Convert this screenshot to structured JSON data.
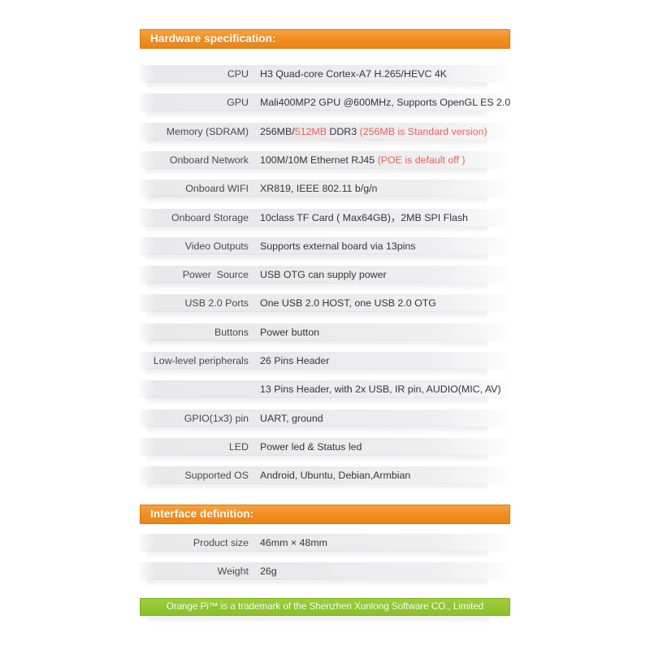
{
  "sections": {
    "hardware": {
      "title": "Hardware specification:"
    },
    "interface": {
      "title": "Interface definition:"
    }
  },
  "hardware_rows": [
    {
      "label": "CPU",
      "value": "H3 Quad-core Cortex-A7 H.265/HEVC 4K"
    },
    {
      "label": "GPU",
      "value": "Mali400MP2 GPU @600MHz, Supports OpenGL ES 2.0"
    },
    {
      "label": "Memory (SDRAM)",
      "value": "256MB/512MB DDR3 (256MB is Standard version)"
    },
    {
      "label": "Onboard Network",
      "value": "100M/10M Ethernet RJ45 (POE is default off )"
    },
    {
      "label": "Onboard WIFI",
      "value": "XR819, IEEE 802.11 b/g/n"
    },
    {
      "label": "Onboard Storage",
      "value": "10class TF Card ( Max64GB)，2MB SPI Flash"
    },
    {
      "label": "Video Outputs",
      "value": "Supports external board via 13pins"
    },
    {
      "label": "Power  Source",
      "value": "USB OTG can supply power"
    },
    {
      "label": "USB 2.0 Ports",
      "value": "One USB 2.0 HOST, one USB 2.0 OTG"
    },
    {
      "label": "Buttons",
      "value": "Power button"
    },
    {
      "label": "Low-level peripherals",
      "value": "26 Pins Header"
    },
    {
      "label": "",
      "value": "13 Pins Header, with 2x USB, IR pin, AUDIO(MIC, AV)"
    },
    {
      "label": "GPIO(1x3) pin",
      "value": "UART, ground"
    },
    {
      "label": "LED",
      "value": "Power led & Status led"
    },
    {
      "label": "Supported OS",
      "value": "Android, Ubuntu, Debian,Armbian"
    }
  ],
  "interface_rows": [
    {
      "label": "Product size",
      "value": "46mm × 48mm"
    },
    {
      "label": "Weight",
      "value": "26g"
    }
  ],
  "highlights": {
    "memory": {
      "prefix": "256MB/",
      "red1": "512MB",
      "middle": " DDR3 ",
      "red2": "(256MB is Standard version)"
    },
    "network": {
      "prefix": "100M/10M Ethernet RJ45 ",
      "red": "(POE is default off )"
    }
  },
  "footer": {
    "text": "Orange Pi™ is a trademark of the Shenzhen Xunlong Software CO., Limited"
  },
  "colors": {
    "orange": "#f18f22",
    "green": "#93c632",
    "red": "#e9615d",
    "row_band": "#eaeaec"
  }
}
